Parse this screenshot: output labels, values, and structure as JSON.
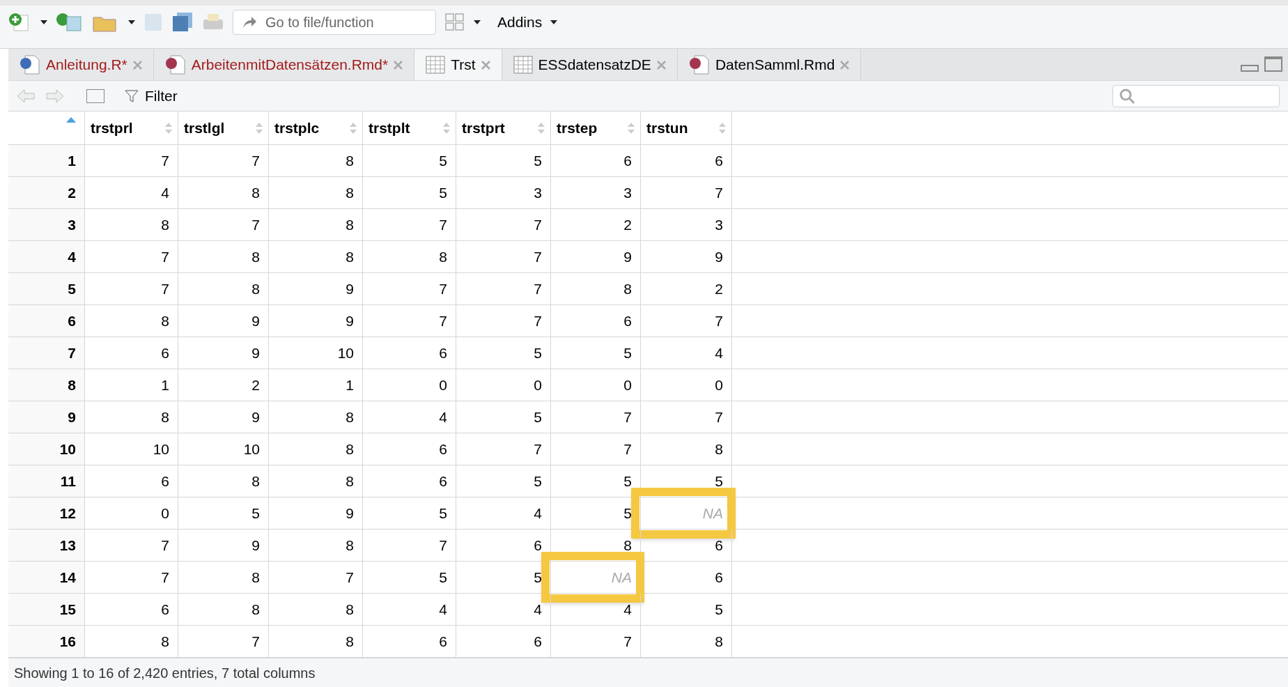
{
  "toolbar": {
    "search_placeholder": "Go to file/function",
    "addins": "Addins"
  },
  "tabs": [
    {
      "label": "Anleitung.R*",
      "kind": "r",
      "modified": true,
      "selected": false
    },
    {
      "label": "ArbeitenmitDatensätzen.Rmd*",
      "kind": "rmd",
      "modified": true,
      "selected": false
    },
    {
      "label": "Trst",
      "kind": "data",
      "modified": false,
      "selected": true
    },
    {
      "label": "ESSdatensatzDE",
      "kind": "data",
      "modified": false,
      "selected": false
    },
    {
      "label": "DatenSamml.Rmd",
      "kind": "rmd",
      "modified": false,
      "selected": false
    }
  ],
  "viewer_toolbar": {
    "filter": "Filter"
  },
  "table": {
    "columns": [
      "trstprl",
      "trstlgl",
      "trstplc",
      "trstplt",
      "trstprt",
      "trstep",
      "trstun"
    ],
    "rows": [
      {
        "num": "1",
        "cells": [
          "7",
          "7",
          "8",
          "5",
          "5",
          "6",
          "6"
        ]
      },
      {
        "num": "2",
        "cells": [
          "4",
          "8",
          "8",
          "5",
          "3",
          "3",
          "7"
        ]
      },
      {
        "num": "3",
        "cells": [
          "8",
          "7",
          "8",
          "7",
          "7",
          "2",
          "3"
        ]
      },
      {
        "num": "4",
        "cells": [
          "7",
          "8",
          "8",
          "8",
          "7",
          "9",
          "9"
        ]
      },
      {
        "num": "5",
        "cells": [
          "7",
          "8",
          "9",
          "7",
          "7",
          "8",
          "2"
        ]
      },
      {
        "num": "6",
        "cells": [
          "8",
          "9",
          "9",
          "7",
          "7",
          "6",
          "7"
        ]
      },
      {
        "num": "7",
        "cells": [
          "6",
          "9",
          "10",
          "6",
          "5",
          "5",
          "4"
        ]
      },
      {
        "num": "8",
        "cells": [
          "1",
          "2",
          "1",
          "0",
          "0",
          "0",
          "0"
        ]
      },
      {
        "num": "9",
        "cells": [
          "8",
          "9",
          "8",
          "4",
          "5",
          "7",
          "7"
        ]
      },
      {
        "num": "10",
        "cells": [
          "10",
          "10",
          "8",
          "6",
          "7",
          "7",
          "8"
        ]
      },
      {
        "num": "11",
        "cells": [
          "6",
          "8",
          "8",
          "6",
          "5",
          "5",
          "5"
        ]
      },
      {
        "num": "12",
        "cells": [
          "0",
          "5",
          "9",
          "5",
          "4",
          "5",
          {
            "value": "NA",
            "missing": true,
            "highlighted": true
          }
        ]
      },
      {
        "num": "13",
        "cells": [
          "7",
          "9",
          "8",
          "7",
          "6",
          "8",
          "6"
        ]
      },
      {
        "num": "14",
        "cells": [
          "7",
          "8",
          "7",
          "5",
          "5",
          {
            "value": "NA",
            "missing": true,
            "highlighted": true
          },
          "6"
        ]
      },
      {
        "num": "15",
        "cells": [
          "6",
          "8",
          "8",
          "4",
          "4",
          "4",
          "5"
        ]
      },
      {
        "num": "16",
        "cells": [
          "8",
          "7",
          "8",
          "6",
          "6",
          "7",
          "8"
        ]
      }
    ]
  },
  "status_bar": "Showing 1 to 16 of 2,420 entries, 7 total columns"
}
